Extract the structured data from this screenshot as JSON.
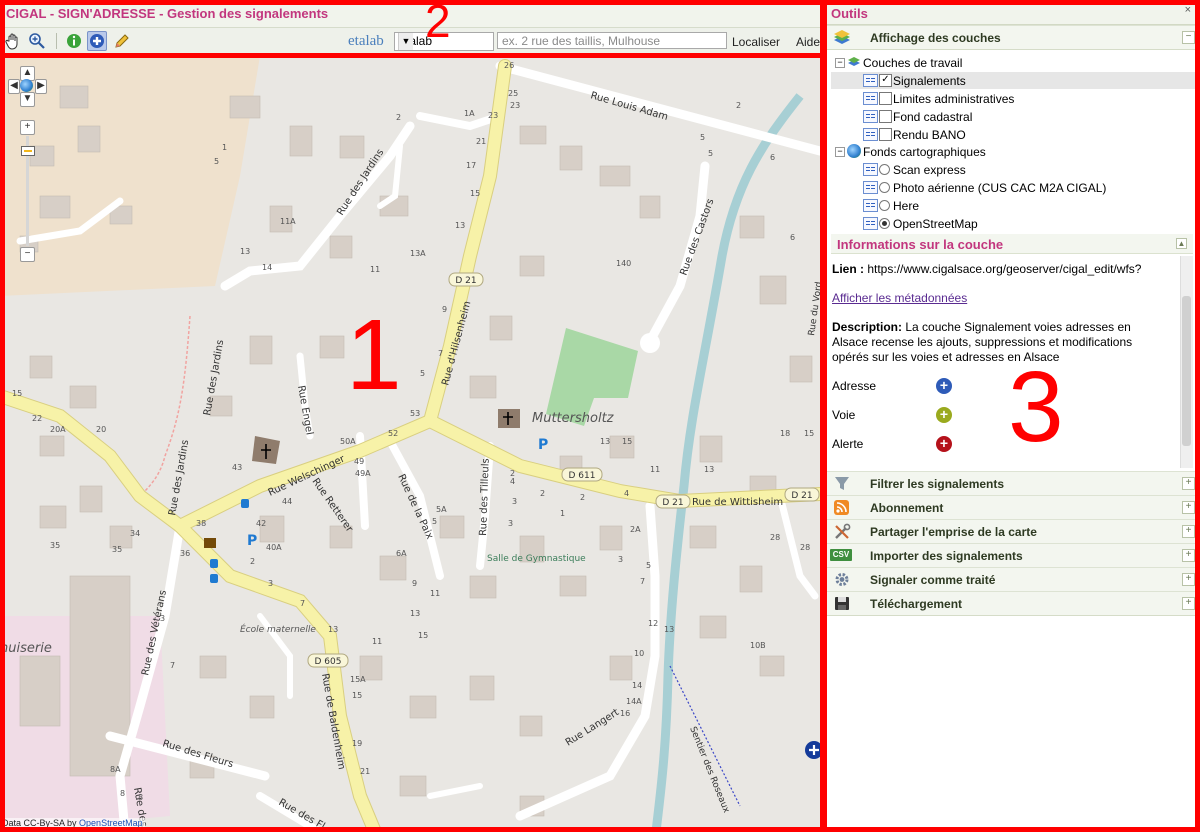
{
  "app": {
    "title": "CIGAL - SIGN'ADRESSE - Gestion des signalements"
  },
  "toolbar": {
    "logo": "etalab",
    "source_select": "Etalab",
    "search_placeholder": "ex. 2 rue des taillis, Mulhouse",
    "locate_label": "Localiser",
    "help_label": "Aide",
    "tools": [
      "pan-hand-icon",
      "zoom-in-icon",
      "info-icon",
      "add-icon",
      "pencil-icon"
    ]
  },
  "map": {
    "attribution_prefix": "Data CC-By-SA by",
    "attribution_link": "OpenStreetMap",
    "place_name": "Muttersholtz",
    "streets": {
      "louis_adam": "Rue Louis Adam",
      "jardins_n": "Rue des Jardins",
      "jardins_w": "Rue des Jardins",
      "jardins_sw": "Rue des Jardins",
      "castors": "Rue des Castors",
      "hilsenheim": "Rue d'Hilsenheim",
      "engel": "Rue Engel",
      "welschinger": "Rue Welschinger",
      "retterer": "Rue Retterer",
      "paix": "Rue de la Paix",
      "tilleuls": "Rue des Tilleuls",
      "wittisheim": "Rue de Wittisheim",
      "veterans": "Rue des Vétérans",
      "baldenheim": "Rue de Baldenheim",
      "fleurs": "Rue des Fleurs",
      "langert": "Rue Langert",
      "roseaux": "Sentier des Roseaux",
      "de_bottom": "Rue des",
      "de_fl": "Rue des Fl",
      "verdure": "Rue du Vord"
    },
    "road_refs": {
      "d21a": "D 21",
      "d21b": "D 21",
      "d21c": "D 21",
      "d611": "D 611",
      "d605": "D 605"
    },
    "pois": {
      "salle": "Salle de Gymnastique",
      "ecole": "École maternelle",
      "menuiserie": "nuiserie"
    },
    "zoom_labels": {
      "plus": "+",
      "minus": "−"
    }
  },
  "panel": {
    "title": "Outils",
    "close": "×",
    "sections": {
      "layers": "Affichage des couches",
      "filter": "Filtrer les signalements",
      "subscribe": "Abonnement",
      "share": "Partager l'emprise de la carte",
      "import": "Importer des signalements",
      "mark_done": "Signaler comme traité",
      "download": "Téléchargement"
    },
    "import_badge": "CSV",
    "tree": {
      "work_group": "Couches de travail",
      "work_layers": [
        {
          "label": "Signalements",
          "checked": true
        },
        {
          "label": "Limites administratives",
          "checked": false
        },
        {
          "label": "Fond cadastral",
          "checked": false
        },
        {
          "label": "Rendu BANO",
          "checked": false
        }
      ],
      "base_group": "Fonds cartographiques",
      "base_layers": [
        {
          "label": "Scan express",
          "selected": false
        },
        {
          "label": "Photo aérienne (CUS CAC M2A CIGAL)",
          "selected": false
        },
        {
          "label": "Here",
          "selected": false
        },
        {
          "label": "OpenStreetMap",
          "selected": true
        }
      ]
    },
    "info": {
      "title": "Informations sur la couche",
      "link_label": "Lien :",
      "link_url": "https://www.cigalsace.org/geoserver/cigal_edit/wfs?",
      "metadata_link": "Afficher les métadonnées",
      "description_label": "Description:",
      "description": "La couche Signalement voies adresses en Alsace recense les ajouts, suppressions et modifications opérés sur les voies et adresses en Alsace",
      "legend": [
        {
          "label": "Adresse",
          "color": "#2e5bb8"
        },
        {
          "label": "Voie",
          "color": "#9aaa1e"
        },
        {
          "label": "Alerte",
          "color": "#b5121b"
        }
      ]
    }
  },
  "annotations": {
    "n1": "1",
    "n2": "2",
    "n3": "3"
  },
  "colors": {
    "title": "#c2367e",
    "highlight": "#ff0000",
    "main_road": "#f7f2a8"
  }
}
